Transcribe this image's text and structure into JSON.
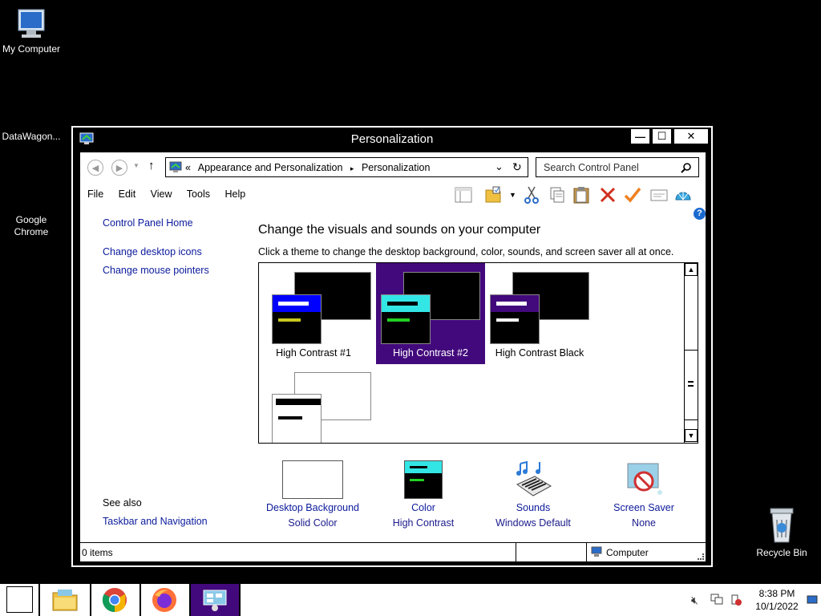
{
  "desktop": {
    "icons": [
      {
        "label": "My Computer"
      },
      {
        "label": "DataWagon..."
      },
      {
        "label": "Google Chrome"
      },
      {
        "label": "Recycle Bin"
      }
    ]
  },
  "window": {
    "title": "Personalization",
    "controls": {
      "minimize": "—",
      "maximize": "☐",
      "close": "✕"
    }
  },
  "address": {
    "prefix": "«",
    "crumbs": [
      "Appearance and Personalization",
      "Personalization"
    ],
    "separator": "▸",
    "search_placeholder": "Search Control Panel"
  },
  "menu": [
    "File",
    "Edit",
    "View",
    "Tools",
    "Help"
  ],
  "sidebar": {
    "home": "Control Panel Home",
    "links": [
      "Change desktop icons",
      "Change mouse pointers"
    ],
    "see_also_label": "See also",
    "see_also_links": [
      "Taskbar and Navigation"
    ]
  },
  "main": {
    "heading": "Change the visuals and sounds on your computer",
    "subheading": "Click a theme to change the desktop background, color, sounds, and screen saver all at once.",
    "themes": [
      {
        "name": "High Contrast #1",
        "bar": "#0000ff",
        "line1": "#ffffff",
        "line2": "#c8c81e",
        "selected": false
      },
      {
        "name": "High Contrast #2",
        "bar": "#33e6e6",
        "line1": "#000000",
        "line2": "#22d022",
        "selected": true
      },
      {
        "name": "High Contrast Black",
        "bar": "#42097c",
        "line1": "#ffffff",
        "line2": "#ffffff",
        "selected": false
      },
      {
        "name": "",
        "bar": "#ffffff",
        "line1": "#000000",
        "line2": "#000000",
        "selected": false
      }
    ]
  },
  "settings": [
    {
      "title": "Desktop Background",
      "value": "Solid Color",
      "icon": "desktop-background-icon"
    },
    {
      "title": "Color",
      "value": "High Contrast",
      "icon": "color-icon"
    },
    {
      "title": "Sounds",
      "value": "Windows Default",
      "icon": "sounds-icon"
    },
    {
      "title": "Screen Saver",
      "value": "None",
      "icon": "screen-saver-icon"
    }
  ],
  "status": {
    "items": "0 items",
    "location": "Computer"
  },
  "taskbar": {
    "clock_time": "8:38 PM",
    "clock_date": "10/1/2022"
  },
  "colors": {
    "selection": "#42097c",
    "link": "#0b1a9c"
  }
}
